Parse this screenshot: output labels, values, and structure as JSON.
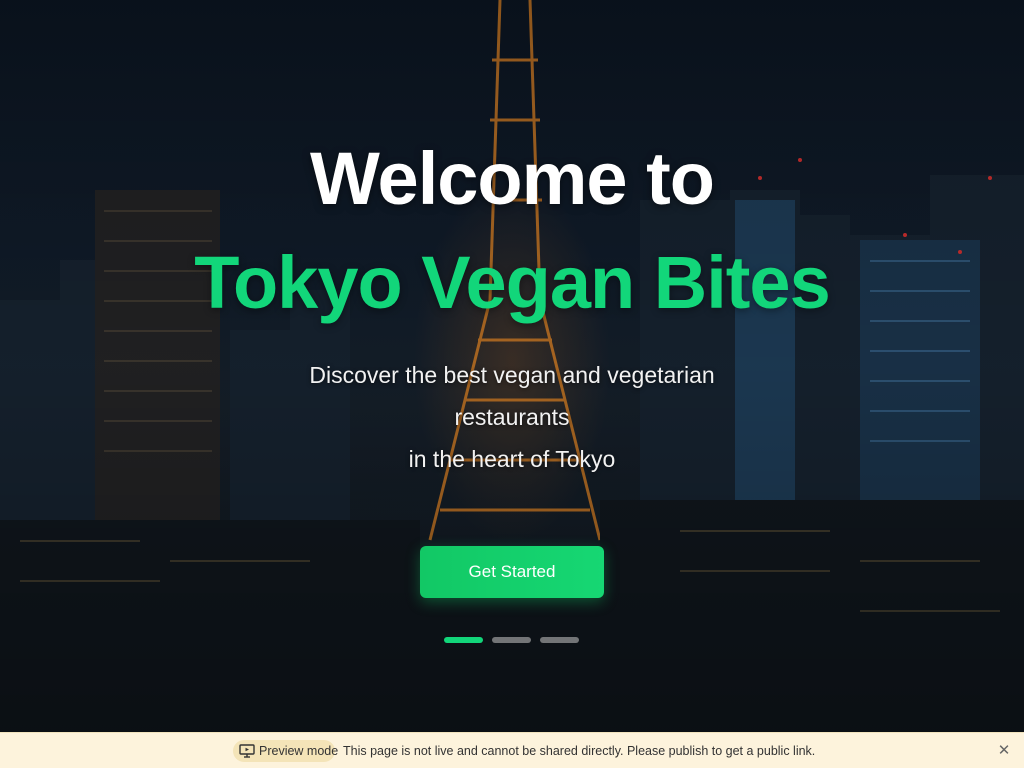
{
  "hero": {
    "title_line1": "Welcome to",
    "title_line2": "Tokyo Vegan Bites",
    "subtitle_lines": [
      "Discover the best vegan and vegetarian",
      "restaurants",
      "in the heart of Tokyo"
    ],
    "cta_label": "Get Started",
    "slides": {
      "count": 3,
      "active_index": 0
    }
  },
  "preview_bar": {
    "label": "Preview mode",
    "message": "This page is not live and cannot be shared directly. Please publish to get a public link.",
    "close_icon": "close-icon",
    "preview_icon": "monitor-icon"
  },
  "colors": {
    "accent": "#12d67a",
    "button": "#12c865",
    "preview_bar_bg": "#fdf3dc"
  }
}
